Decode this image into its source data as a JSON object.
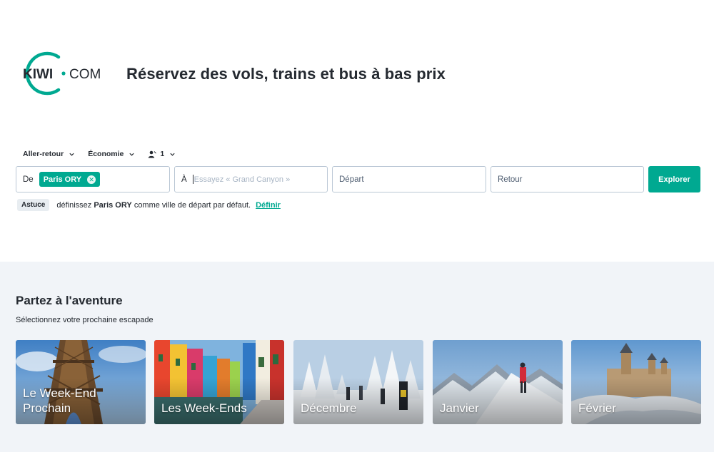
{
  "brand": {
    "logo_text": "KIWI",
    "logo_text_2": "COM",
    "accent": "#00a991"
  },
  "header": {
    "headline": "Réservez des vols, trains et bus à bas prix"
  },
  "options": {
    "trip_type": "Aller-retour",
    "cabin_class": "Économie",
    "passengers": "1"
  },
  "search": {
    "from_label": "De",
    "from_chip": "Paris ORY",
    "to_label": "À",
    "to_placeholder": "Essayez « Grand Canyon »",
    "depart_placeholder": "Départ",
    "return_placeholder": "Retour",
    "explore_label": "Explorer"
  },
  "tip": {
    "badge": "Astuce",
    "text_before": "définissez",
    "city": "Paris ORY",
    "text_after": "comme ville de départ par défaut.",
    "link": "Définir"
  },
  "adventure": {
    "title": "Partez à l'aventure",
    "subtitle": "Sélectionnez votre prochaine escapade",
    "cards": [
      {
        "label": "Le Week-End Prochain"
      },
      {
        "label": "Les Week-Ends"
      },
      {
        "label": "Décembre"
      },
      {
        "label": "Janvier"
      },
      {
        "label": "Février"
      }
    ]
  }
}
